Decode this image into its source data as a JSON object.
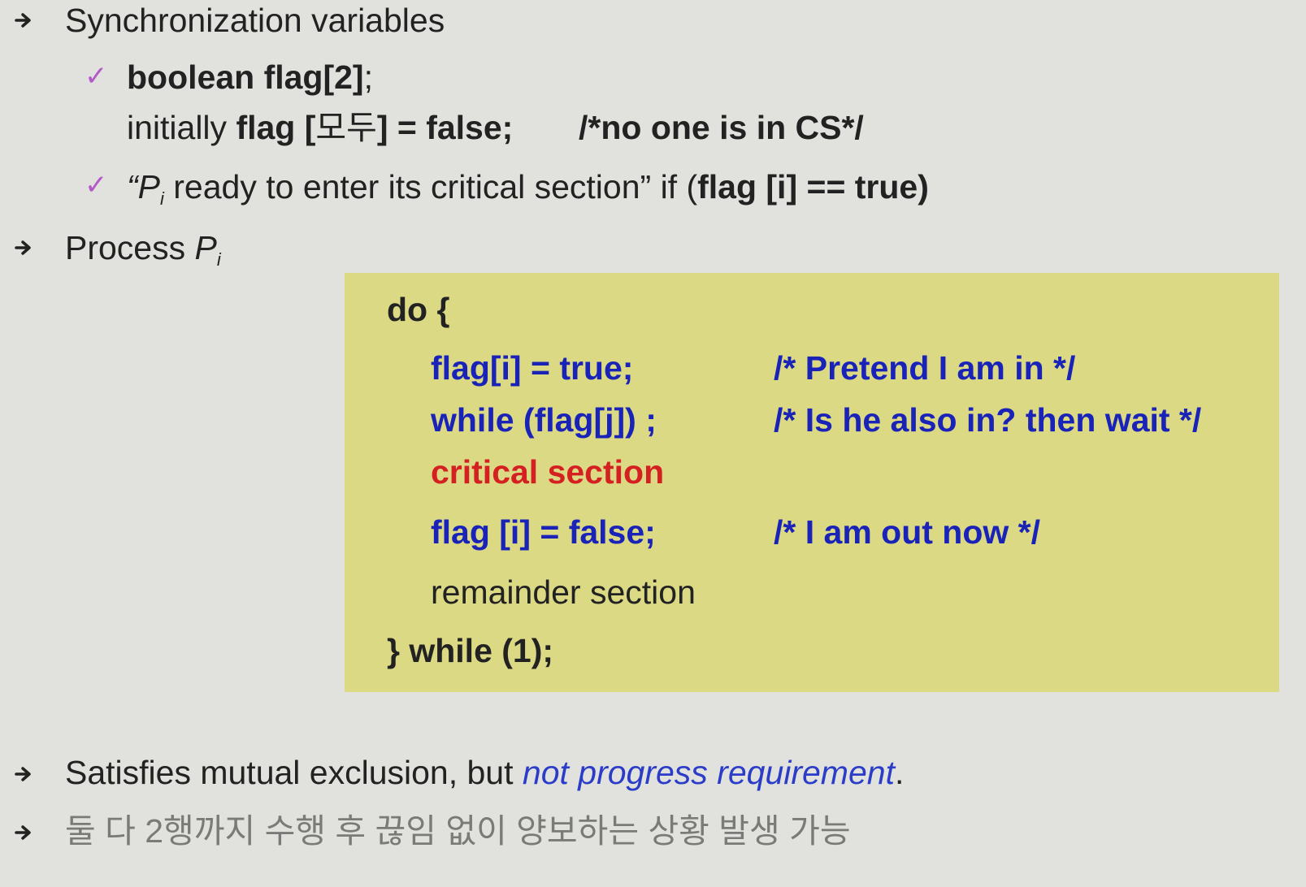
{
  "bullets": {
    "sync_vars": "Synchronization variables",
    "flag_decl": "boolean flag[2]",
    "flag_decl_semicolon": ";",
    "init_prefix": "initially ",
    "init_flag": "flag [",
    "init_korean": "모두",
    "init_rest": "] = false;",
    "init_comment": "/*no one is in CS*/",
    "ready_open_quote": "“P",
    "ready_sub": "i",
    "ready_text": " ready to enter its critical section” if (",
    "ready_cond": "flag [i] == true",
    "ready_close": ")",
    "process_prefix": "Process ",
    "process_p": "P",
    "process_sub": "i",
    "satisfies_text": "Satisfies mutual exclusion, but ",
    "satisfies_highlight": "not progress requirement",
    "satisfies_end": ".",
    "korean_note": "둘 다 2행까지 수행 후 끊임 없이 양보하는 상황 발생 가능"
  },
  "code": {
    "line_do": "do {",
    "line_flag_true": "flag[i] = true;",
    "comment_pretend": "/* Pretend  I am in */",
    "line_while": "while (flag[j]) ;",
    "comment_wait": "/* Is he also in? then wait */",
    "line_critical": "critical section",
    "line_flag_false": "flag [i] = false;",
    "comment_out": "/* I am out now */",
    "line_remainder": "remainder section",
    "line_end": "} while (1);"
  },
  "colors": {
    "background": "#e1e1dd",
    "code_box": "#dcd985",
    "code_blue": "#1a23b8",
    "code_red": "#d42020",
    "check_purple": "#b45ac8"
  },
  "icons": {
    "bullet": "arrow-bullet-icon",
    "check": "checkmark-icon"
  }
}
